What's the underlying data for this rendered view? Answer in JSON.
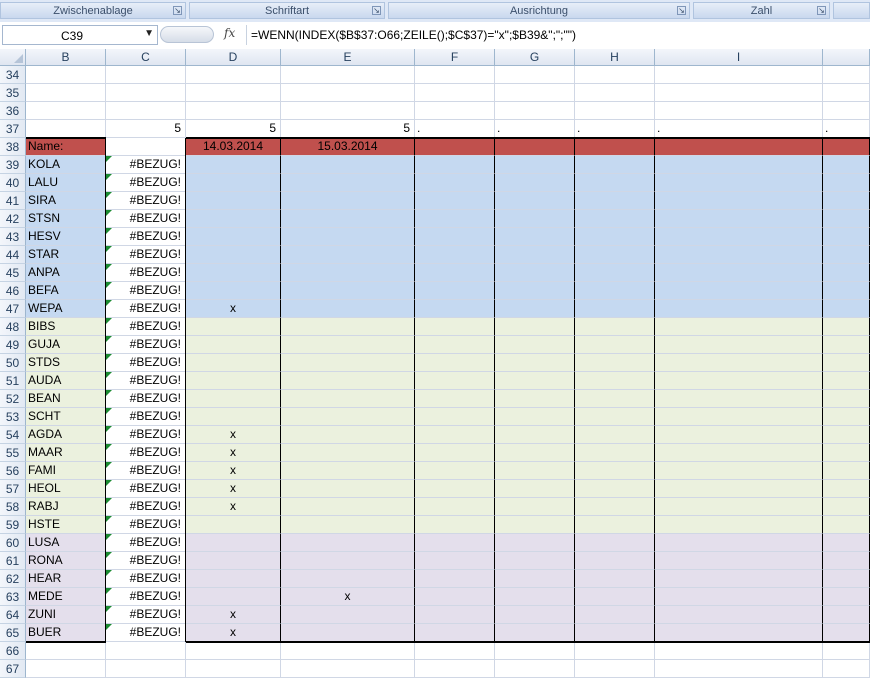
{
  "ribbon": {
    "groups": [
      "Zwischenablage",
      "Schriftart",
      "Ausrichtung",
      "Zahl"
    ]
  },
  "formula_bar": {
    "name_box": "C39",
    "fx_label": "fx",
    "formula": "=WENN(INDEX($B$37:O66;ZEILE();$C$37)=\"x\";$B39&\";\";\"\")"
  },
  "sheet": {
    "columns": [
      "B",
      "C",
      "D",
      "E",
      "F",
      "G",
      "H",
      "I"
    ],
    "row37": {
      "C": "5",
      "D": "5",
      "E": "5",
      "F": ".",
      "G": ".",
      "H": ".",
      "I": ".",
      "J": "."
    },
    "header_row": {
      "label": "Name:",
      "D": "14.03.2014",
      "E": "15.03.2014"
    },
    "error_value": "#BEZUG!",
    "rows": [
      {
        "n": "39",
        "name": "KOLA",
        "D": "",
        "E": "",
        "group": "blue"
      },
      {
        "n": "40",
        "name": "LALU",
        "D": "",
        "E": "",
        "group": "blue"
      },
      {
        "n": "41",
        "name": "SIRA",
        "D": "",
        "E": "",
        "group": "blue"
      },
      {
        "n": "42",
        "name": "STSN",
        "D": "",
        "E": "",
        "group": "blue"
      },
      {
        "n": "43",
        "name": "HESV",
        "D": "",
        "E": "",
        "group": "blue"
      },
      {
        "n": "44",
        "name": "STAR",
        "D": "",
        "E": "",
        "group": "blue"
      },
      {
        "n": "45",
        "name": "ANPA",
        "D": "",
        "E": "",
        "group": "blue"
      },
      {
        "n": "46",
        "name": "BEFA",
        "D": "",
        "E": "",
        "group": "blue"
      },
      {
        "n": "47",
        "name": "WEPA",
        "D": "x",
        "E": "",
        "group": "blue"
      },
      {
        "n": "48",
        "name": "BIBS",
        "D": "",
        "E": "",
        "group": "green"
      },
      {
        "n": "49",
        "name": "GUJA",
        "D": "",
        "E": "",
        "group": "green"
      },
      {
        "n": "50",
        "name": "STDS",
        "D": "",
        "E": "",
        "group": "green"
      },
      {
        "n": "51",
        "name": "AUDA",
        "D": "",
        "E": "",
        "group": "green"
      },
      {
        "n": "52",
        "name": "BEAN",
        "D": "",
        "E": "",
        "group": "green"
      },
      {
        "n": "53",
        "name": "SCHT",
        "D": "",
        "E": "",
        "group": "green"
      },
      {
        "n": "54",
        "name": "AGDA",
        "D": "x",
        "E": "",
        "group": "green"
      },
      {
        "n": "55",
        "name": "MAAR",
        "D": "x",
        "E": "",
        "group": "green"
      },
      {
        "n": "56",
        "name": "FAMI",
        "D": "x",
        "E": "",
        "group": "green"
      },
      {
        "n": "57",
        "name": "HEOL",
        "D": "x",
        "E": "",
        "group": "green"
      },
      {
        "n": "58",
        "name": "RABJ",
        "D": "x",
        "E": "",
        "group": "green"
      },
      {
        "n": "59",
        "name": "HSTE",
        "D": "",
        "E": "",
        "group": "green"
      },
      {
        "n": "60",
        "name": "LUSA",
        "D": "",
        "E": "",
        "group": "purple"
      },
      {
        "n": "61",
        "name": "RONA",
        "D": "",
        "E": "",
        "group": "purple"
      },
      {
        "n": "62",
        "name": "HEAR",
        "D": "",
        "E": "",
        "group": "purple"
      },
      {
        "n": "63",
        "name": "MEDE",
        "D": "",
        "E": "x",
        "group": "purple"
      },
      {
        "n": "64",
        "name": "ZUNI",
        "D": "x",
        "E": "",
        "group": "purple"
      },
      {
        "n": "65",
        "name": "BUER",
        "D": "x",
        "E": "",
        "group": "purple"
      }
    ],
    "empty_rows_top": [
      "34",
      "35",
      "36"
    ],
    "row37_label": "37",
    "row38_label": "38",
    "empty_rows_bottom": [
      "66",
      "67"
    ]
  },
  "colors": {
    "header_red": "#c0504d",
    "blue": "#c5d9f1",
    "green": "#ebf1de",
    "purple": "#e4dfec",
    "error_indicator": "#1c8b32"
  }
}
